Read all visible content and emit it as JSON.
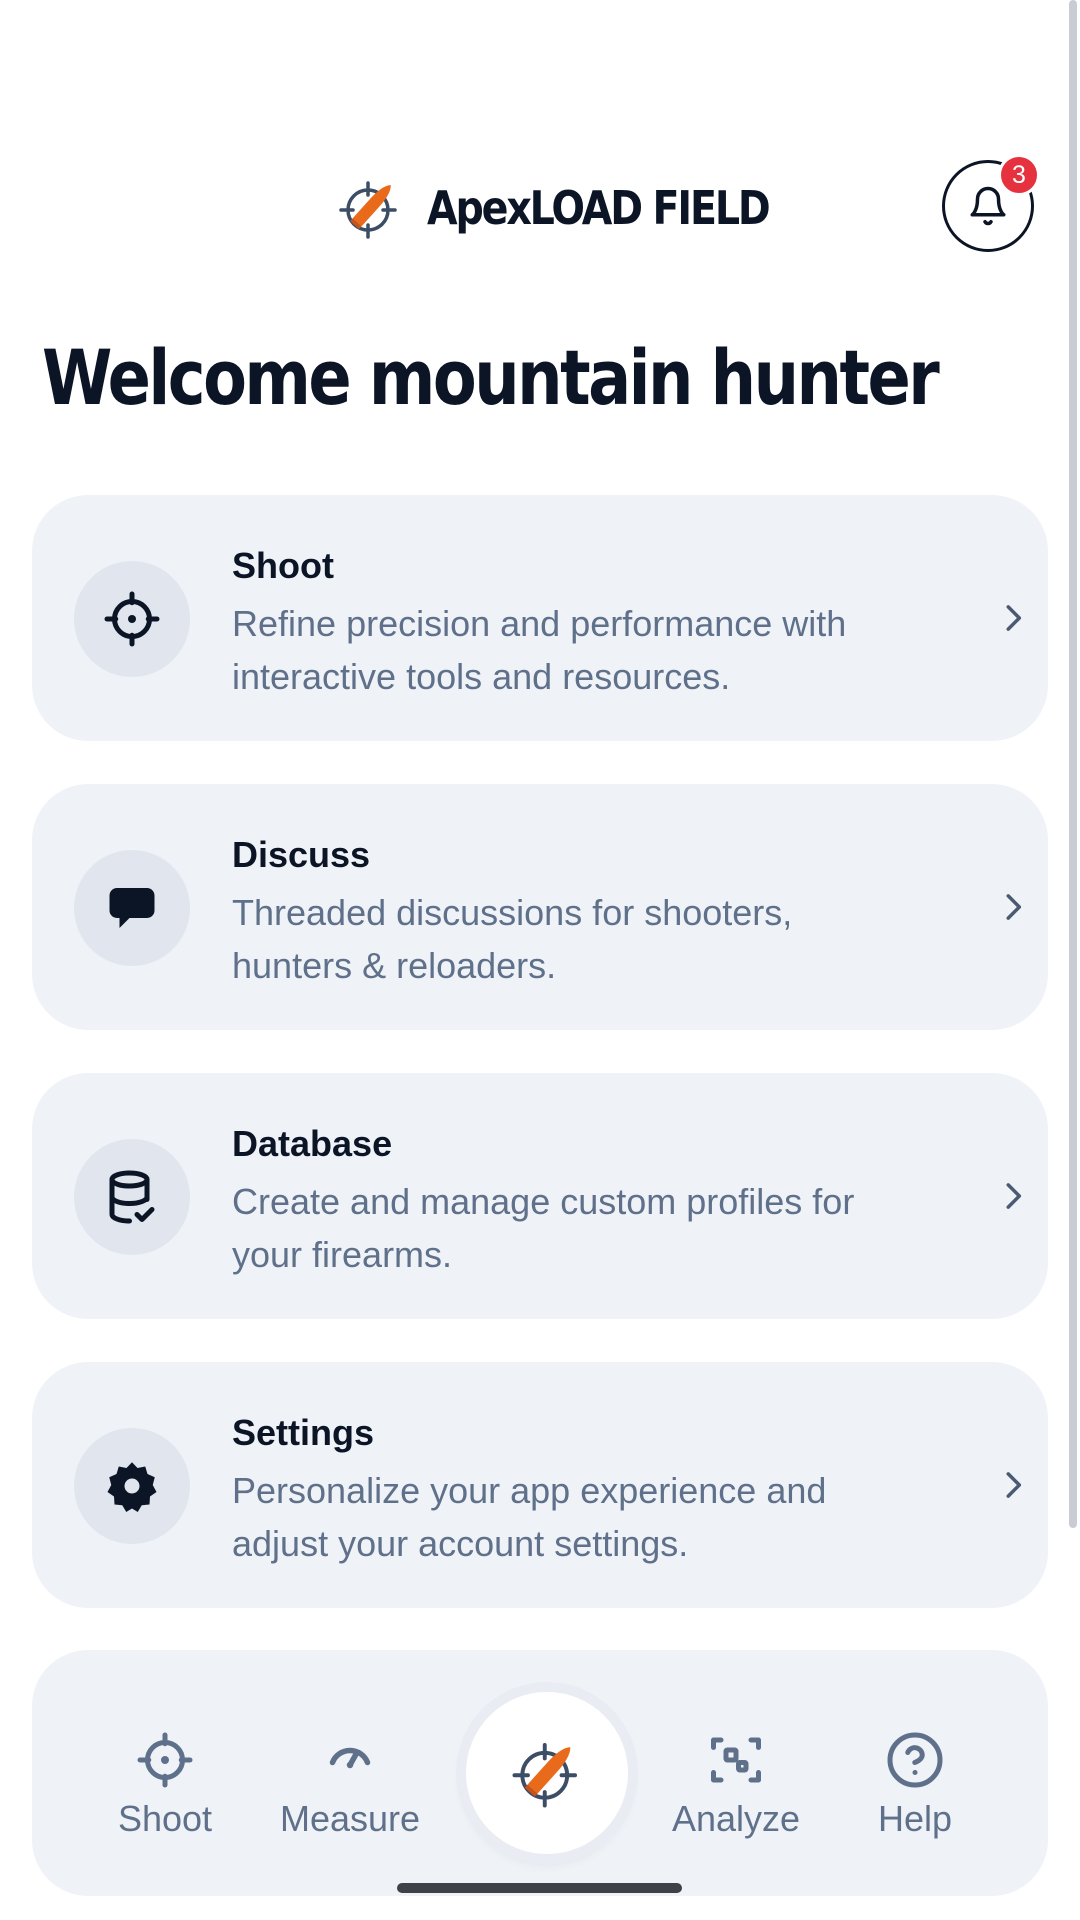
{
  "header": {
    "brand_name": "ApexLOAD FIELD",
    "logo_icon": "crosshair-bullet-logo",
    "notifications": {
      "icon": "bell-icon",
      "badge_count": "3"
    }
  },
  "welcome": {
    "title": "Welcome mountain hunter"
  },
  "menu": {
    "items": [
      {
        "icon": "crosshair-icon",
        "title": "Shoot",
        "description": "Refine precision and performance with interactive tools and resources."
      },
      {
        "icon": "chat-bubble-icon",
        "title": "Discuss",
        "description": "Threaded discussions for shooters, hunters & reloaders."
      },
      {
        "icon": "database-check-icon",
        "title": "Database",
        "description": "Create and manage custom profiles for your firearms."
      },
      {
        "icon": "gear-icon",
        "title": "Settings",
        "description": "Personalize your app experience and adjust your account settings."
      }
    ]
  },
  "bottom_nav": {
    "items": [
      {
        "icon": "crosshair-icon",
        "label": "Shoot"
      },
      {
        "icon": "gauge-icon",
        "label": "Measure"
      },
      {
        "icon": "scan-icon",
        "label": "Analyze"
      },
      {
        "icon": "help-circle-icon",
        "label": "Help"
      }
    ],
    "center": {
      "icon": "crosshair-bullet-logo"
    }
  },
  "colors": {
    "text_primary": "#0c1526",
    "text_secondary": "#5f708a",
    "card_background": "#eff2f7",
    "icon_circle": "#e1e6ee",
    "badge": "#e5323e",
    "logo_accent": "#ea6a1c"
  }
}
